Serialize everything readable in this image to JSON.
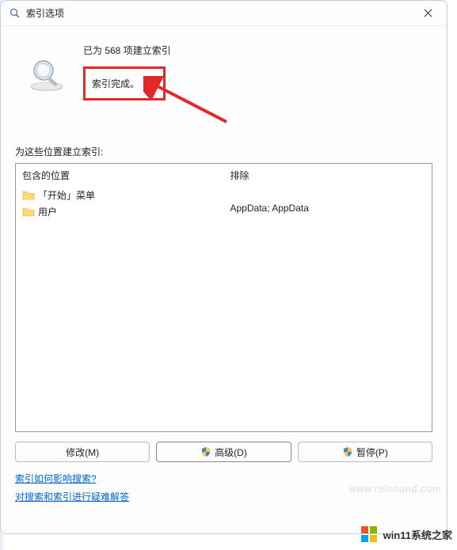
{
  "titlebar": {
    "title": "索引选项"
  },
  "status": {
    "indexed_count_text": "已为 568 项建立索引",
    "complete_text": "索引完成。"
  },
  "section": {
    "label": "为这些位置建立索引:"
  },
  "columns": {
    "included_header": "包含的位置",
    "excluded_header": "排除"
  },
  "locations": [
    {
      "label": "「开始」菜单"
    },
    {
      "label": "用户"
    }
  ],
  "exclusions": {
    "text": "AppData; AppData"
  },
  "buttons": {
    "modify": "修改(M)",
    "advanced": "高级(D)",
    "pause": "暂停(P)"
  },
  "links": {
    "how_affects": "索引如何影响搜索?",
    "troubleshoot": "对搜索和索引进行疑难解答"
  },
  "watermark1": "www.relsound.com",
  "watermark2": "win11系统之家"
}
